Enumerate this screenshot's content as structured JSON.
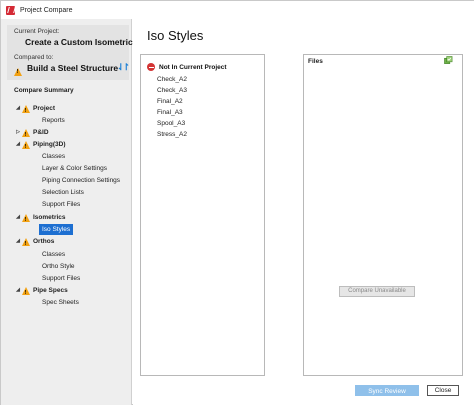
{
  "window": {
    "title": "Project Compare"
  },
  "sidebar": {
    "current_project_label": "Current Project:",
    "current_project_name": "Create a Custom Isometric",
    "compared_to_label": "Compared to:",
    "compared_project_name": "Build a Steel Structure",
    "summary_title": "Compare Summary",
    "tree": [
      {
        "label": "Project",
        "level": 0,
        "warning": true,
        "expanded": true
      },
      {
        "label": "Reports",
        "level": 1
      },
      {
        "label": "P&ID",
        "level": 0,
        "warning": true,
        "expanded": false
      },
      {
        "label": "Piping(3D)",
        "level": 0,
        "warning": true,
        "expanded": true
      },
      {
        "label": "Classes",
        "level": 1
      },
      {
        "label": "Layer & Color Settings",
        "level": 1
      },
      {
        "label": "Piping Connection Settings",
        "level": 1
      },
      {
        "label": "Selection Lists",
        "level": 1
      },
      {
        "label": "Support Files",
        "level": 1
      },
      {
        "label": "Isometrics",
        "level": 0,
        "warning": true,
        "expanded": true
      },
      {
        "label": "Iso Styles",
        "level": 1,
        "selected": true
      },
      {
        "label": "Orthos",
        "level": 0,
        "warning": true,
        "expanded": true
      },
      {
        "label": "Classes",
        "level": 1
      },
      {
        "label": "Ortho Style",
        "level": 1
      },
      {
        "label": "Support Files",
        "level": 1
      },
      {
        "label": "Pipe Specs",
        "level": 0,
        "warning": true,
        "expanded": true
      },
      {
        "label": "Spec Sheets",
        "level": 1
      }
    ]
  },
  "main": {
    "title": "Iso Styles",
    "not_in_current_header": "Not In Current Project",
    "styles": [
      "Check_A2",
      "Check_A3",
      "Final_A2",
      "Final_A3",
      "Spool_A3",
      "Stress_A2"
    ],
    "files_label": "Files",
    "compare_unavailable_label": "Compare Unavailable"
  },
  "footer": {
    "sync_label": "Sync Review",
    "close_label": "Close"
  },
  "colors": {
    "warning": "#f2a112",
    "selection": "#1d6fd1",
    "error": "#d33434",
    "sync_disabled": "#8fc0ea"
  }
}
